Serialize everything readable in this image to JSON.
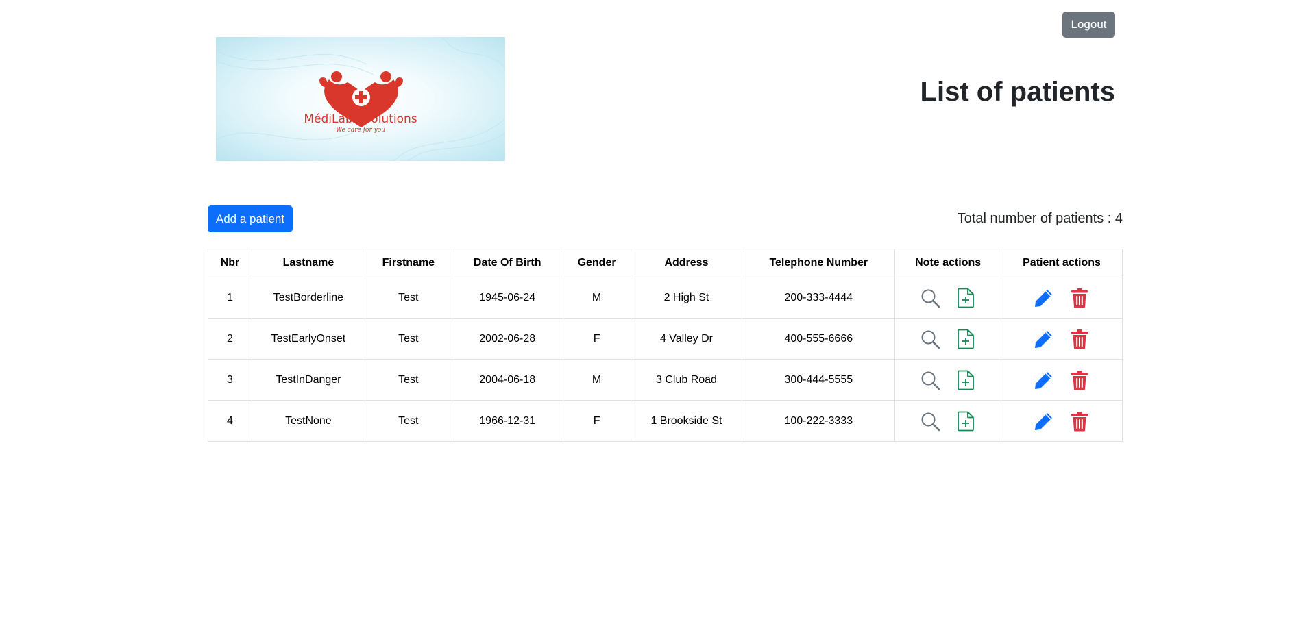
{
  "header": {
    "logout_label": "Logout",
    "title": "List of patients"
  },
  "logo": {
    "brand": "MédiLabo Solutions",
    "tagline": "We care for you",
    "color": "#d9372b"
  },
  "toolbar": {
    "add_label": "Add a patient",
    "total_text": "Total number of patients : 4"
  },
  "table": {
    "columns": [
      "Nbr",
      "Lastname",
      "Firstname",
      "Date Of Birth",
      "Gender",
      "Address",
      "Telephone Number",
      "Note actions",
      "Patient actions"
    ],
    "rows": [
      {
        "nbr": "1",
        "lastname": "TestBorderline",
        "firstname": "Test",
        "dob": "1945-06-24",
        "gender": "M",
        "address": "2 High St",
        "phone": "200-333-4444"
      },
      {
        "nbr": "2",
        "lastname": "TestEarlyOnset",
        "firstname": "Test",
        "dob": "2002-06-28",
        "gender": "F",
        "address": "4 Valley Dr",
        "phone": "400-555-6666"
      },
      {
        "nbr": "3",
        "lastname": "TestInDanger",
        "firstname": "Test",
        "dob": "2004-06-18",
        "gender": "M",
        "address": "3 Club Road",
        "phone": "300-444-5555"
      },
      {
        "nbr": "4",
        "lastname": "TestNone",
        "firstname": "Test",
        "dob": "1966-12-31",
        "gender": "F",
        "address": "1 Brookside St",
        "phone": "100-222-3333"
      }
    ],
    "note_icons": [
      "search-icon",
      "file-plus-icon"
    ],
    "patient_icons": [
      "pencil-icon",
      "trash-icon"
    ]
  },
  "colors": {
    "primary": "#0d6efd",
    "secondary": "#6c757d",
    "success": "#198754",
    "danger": "#dc3545"
  }
}
